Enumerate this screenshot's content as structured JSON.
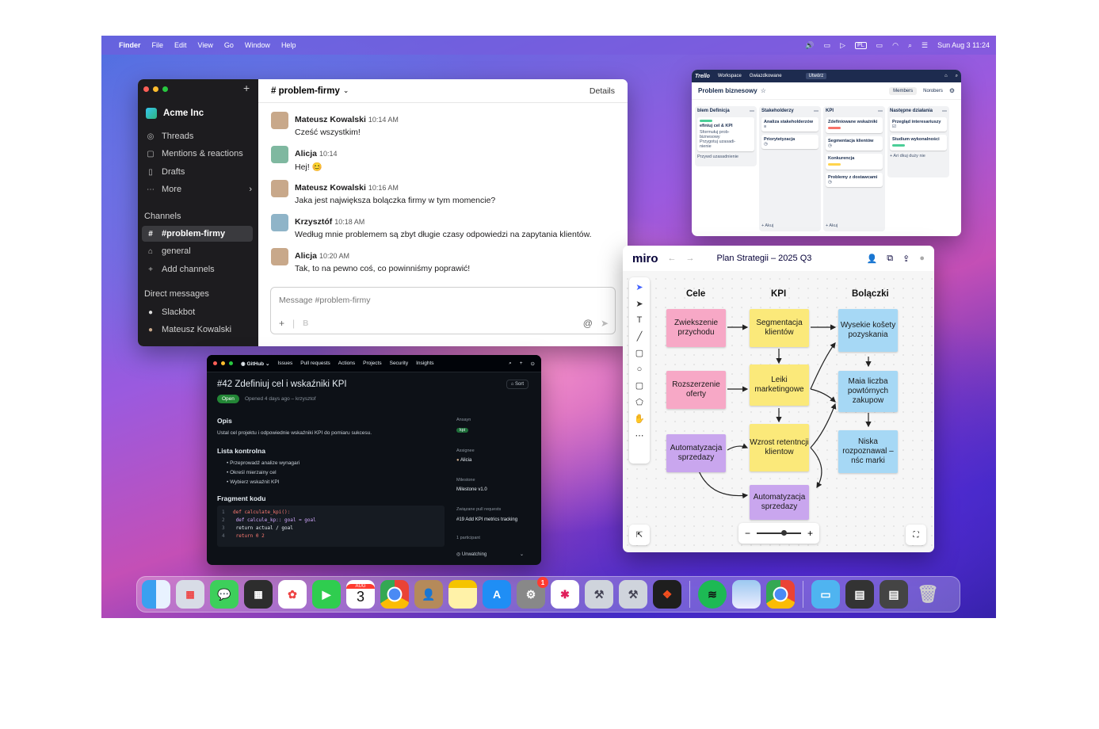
{
  "menubar": {
    "finder": "Finder",
    "items": [
      "File",
      "Edit",
      "View",
      "Go",
      "Window",
      "Help"
    ],
    "lang": "PL",
    "datetime": "Sun Aug 3  11:24"
  },
  "slack": {
    "workspace": "Acme Inc",
    "nav": [
      {
        "icon": "threads-icon",
        "label": "Threads"
      },
      {
        "icon": "mentions-icon",
        "label": "Mentions & reactions"
      },
      {
        "icon": "drafts-icon",
        "label": "Drafts"
      },
      {
        "icon": "more-icon",
        "label": "More"
      }
    ],
    "channels_header": "Channels",
    "channels": [
      "#problem-firmy",
      "general",
      "Add channels"
    ],
    "dm_header": "Direct messages",
    "dms": [
      "Slackbot",
      "Mateusz Kowalski"
    ],
    "channel_title": "# problem-firmy",
    "details": "Details",
    "messages": [
      {
        "name": "Mateusz Kowalski",
        "time": "10:14 AM",
        "text": "Cześć wszystkim!"
      },
      {
        "name": "Alicja",
        "time": "10:14",
        "text": "Hej! 😊"
      },
      {
        "name": "Mateusz Kowalski",
        "time": "10:16 AM",
        "text": "Jaka jest największa bolączka firmy w tym momencie?"
      },
      {
        "name": "Krzysztóf",
        "time": "10:18 AM",
        "text": "Według mnie problemem są zbyt długie czasy odpowiedzi na zapytania klientów."
      },
      {
        "name": "Alicja",
        "time": "10:20 AM",
        "text": "Tak, to na pewno coś, co powinniśmy poprawić!"
      }
    ],
    "composer_placeholder": "Message #problem-firmy"
  },
  "trello": {
    "logo": "Trello",
    "nav": [
      "Workspace",
      "Gwiazdkowane"
    ],
    "create": "Utwórz",
    "board": "Problem biznesowy",
    "members": "Members",
    "share": "Norobers",
    "columns": [
      {
        "title": "blem Definicja",
        "cards": [
          "efiniuj cel & KPI"
        ],
        "notes": [
          "Sformułuj prob-",
          "biznesowy",
          "Przygotuj uzasadi-",
          "nienie"
        ],
        "add": "Przywd uzasadnienie"
      },
      {
        "title": "Stakeholderzy",
        "cards": [
          "Analiza stakeholderzów",
          "Priorytetyzacja"
        ],
        "add": "+ Akuj"
      },
      {
        "title": "KPI",
        "cards": [
          "Zdefiniowane wskaźniki",
          "Segmentacja klientów",
          "Konkurencja",
          "Problemy z dostawcami"
        ],
        "add": "+ Akuj"
      },
      {
        "title": "Następne działania",
        "cards": [
          "Przegląd interesariuszy",
          "Studium wykonalności"
        ],
        "add": "+ Ari dkuj duży nie"
      }
    ],
    "label_colors": [
      "#f87168",
      "#ffd44d",
      "#4bce97"
    ]
  },
  "miro": {
    "logo": "miro",
    "title": "Plan Strategii – 2025 Q3",
    "headers": [
      "Cele",
      "KPI",
      "Bolączki"
    ],
    "cele": [
      "Zwiekszenie przychodu",
      "Rozszerzenie oferty",
      "Automatyzacja sprzedazy"
    ],
    "kpi": [
      "Segmentacja klientów",
      "Leiki marketingowe",
      "Wzrost retentncji klientow",
      "Automatyzacja sprzedazy"
    ],
    "bol": [
      "Wysekie košety pozyskania",
      "Maia liczba powtórnych zakupow",
      "Niska rozpoznawal – nśc marki"
    ],
    "colors": {
      "pink": "#f7a8c6",
      "yellow": "#fbe97a",
      "blue": "#a6d8f5",
      "purple": "#c9a6ee"
    }
  },
  "github": {
    "nav": [
      "GitHub",
      "Issues",
      "Pull requests",
      "Actions",
      "Projects",
      "Security",
      "Insights"
    ],
    "title": "#42  Zdefiniuj cel i wskaźniki KPI",
    "state": "Open",
    "opened": "Opened 4 days ago – krzysztof",
    "sort": "Sort",
    "opis_h": "Opis",
    "opis": "Ustal cel projektu i odpowiednie wskaźniki KPI do pomiaru sukcesu.",
    "lista_h": "Lista kontrolna",
    "lista": [
      "Przeprowadź analize wynagari",
      "Określ mierzainy cel",
      "Wybierz wskaźnit KPI"
    ],
    "code_h": "Fragment kodu",
    "code": [
      [
        "1",
        "def calculate_kpi():"
      ],
      [
        "2",
        "    def calcule_kp:: goal = goal"
      ],
      [
        "3",
        "        return actual / goal"
      ],
      [
        "4",
        "    return 0  2"
      ]
    ],
    "side": [
      {
        "label": "Ansayn",
        "value": "kpi"
      },
      {
        "label": "Assignee",
        "value": "Alicia"
      },
      {
        "label": "Milestone",
        "value": "Milestone v1.0"
      },
      {
        "label": "Związane pull requests",
        "value": "#19 Add KPI metrics tracking"
      },
      {
        "label": "1 participant",
        "value": ""
      },
      {
        "label": "",
        "value": "Unwatching"
      }
    ]
  },
  "dock": {
    "calendar_month": "AUG",
    "calendar_day": "3",
    "badge": "1"
  }
}
